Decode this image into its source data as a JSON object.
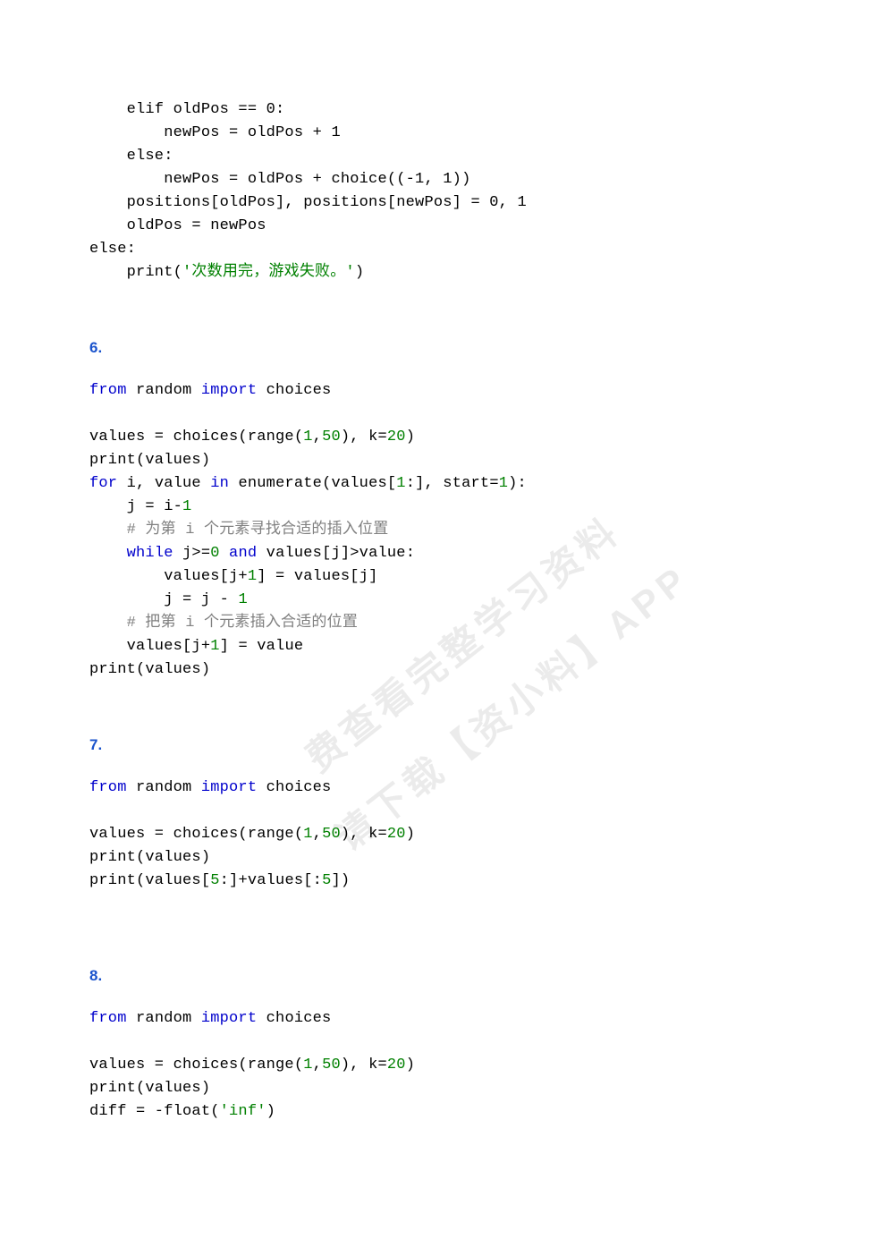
{
  "watermark": {
    "line1": "费查看完整学习资料",
    "line2": "请下载【资小料】APP"
  },
  "block_top": {
    "l1": "    elif oldPos == 0:",
    "l2": "        newPos = oldPos + 1",
    "l3": "    else:",
    "l4": "        newPos = oldPos + choice((-1, 1))",
    "l5": "    positions[oldPos], positions[newPos] = 0, 1",
    "l6": "    oldPos = newPos",
    "l7": "else:",
    "l8_a": "    print(",
    "l8_b": "'次数用完，游戏失败。'",
    "l8_c": ")"
  },
  "sec6": {
    "num": "6.",
    "l1_a": "from",
    "l1_b": " random ",
    "l1_c": "import",
    "l1_d": " choices",
    "l3_a": "values = choices(range(",
    "l3_b": "1",
    "l3_c": ",",
    "l3_d": "50",
    "l3_e": "), k=",
    "l3_f": "20",
    "l3_g": ")",
    "l4": "print(values)",
    "l5_a": "for",
    "l5_b": " i, value ",
    "l5_c": "in",
    "l5_d": " enumerate(values[",
    "l5_e": "1",
    "l5_f": ":], start=",
    "l5_g": "1",
    "l5_h": "):",
    "l6_a": "    j = i-",
    "l6_b": "1",
    "l7": "    # 为第 i 个元素寻找合适的插入位置",
    "l8_a": "    ",
    "l8_b": "while",
    "l8_c": " j>=",
    "l8_d": "0",
    "l8_e": " ",
    "l8_f": "and",
    "l8_g": " values[j]>value:",
    "l9_a": "        values[j+",
    "l9_b": "1",
    "l9_c": "] = values[j]",
    "l10_a": "        j = j - ",
    "l10_b": "1",
    "l11": "    # 把第 i 个元素插入合适的位置",
    "l12_a": "    values[j+",
    "l12_b": "1",
    "l12_c": "] = value",
    "l13": "print(values)"
  },
  "sec7": {
    "num": "7.",
    "l1_a": "from",
    "l1_b": " random ",
    "l1_c": "import",
    "l1_d": " choices",
    "l3_a": "values = choices(range(",
    "l3_b": "1",
    "l3_c": ",",
    "l3_d": "50",
    "l3_e": "), k=",
    "l3_f": "20",
    "l3_g": ")",
    "l4": "print(values)",
    "l5_a": "print(values[",
    "l5_b": "5",
    "l5_c": ":]+values[:",
    "l5_d": "5",
    "l5_e": "])"
  },
  "sec8": {
    "num": "8.",
    "l1_a": "from",
    "l1_b": " random ",
    "l1_c": "import",
    "l1_d": " choices",
    "l3_a": "values = choices(range(",
    "l3_b": "1",
    "l3_c": ",",
    "l3_d": "50",
    "l3_e": "), k=",
    "l3_f": "20",
    "l3_g": ")",
    "l4": "print(values)",
    "l5_a": "diff = -float(",
    "l5_b": "'inf'",
    "l5_c": ")"
  }
}
